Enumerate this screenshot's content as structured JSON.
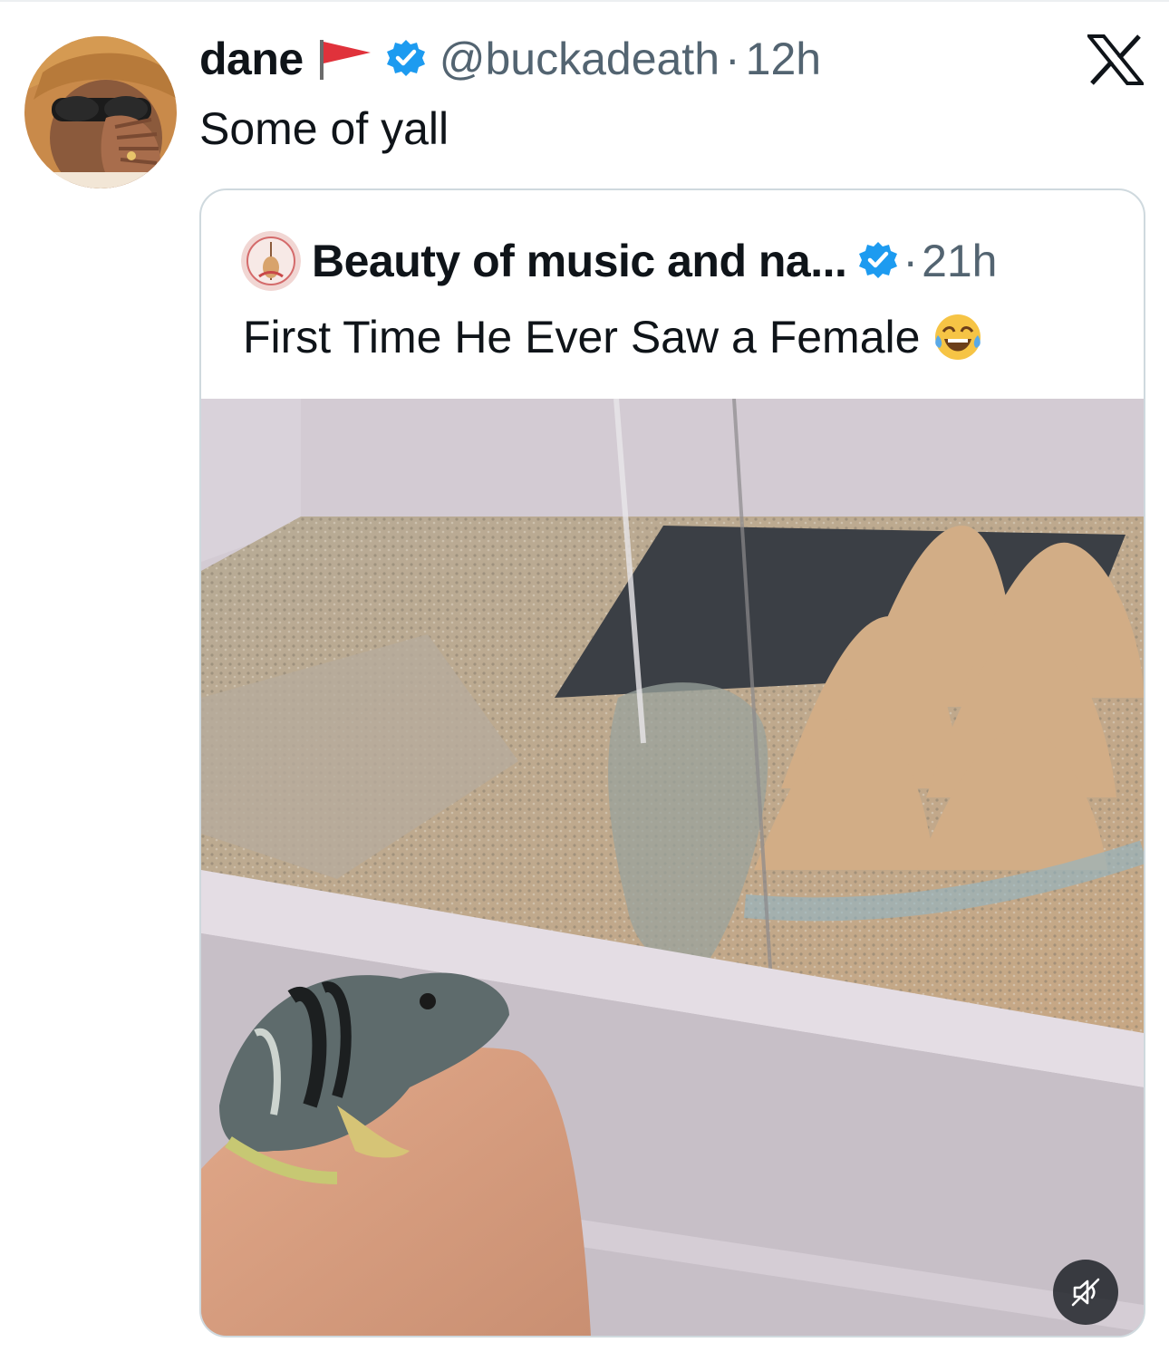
{
  "tweet": {
    "display_name": "dane",
    "handle": "@buckadeath",
    "separator": "·",
    "time": "12h",
    "text": "Some of yall",
    "flag_icon": "triangular-red-flag-icon",
    "verified_icon": "verified-badge-icon",
    "app_icon": "x-logo-icon"
  },
  "quoted_tweet": {
    "display_name": "Beauty of music and na...",
    "separator": "·",
    "time": "21h",
    "text": "First Time He Ever Saw a Female",
    "emoji_icon": "tears-of-joy-emoji-icon",
    "verified_icon": "verified-badge-icon",
    "media": {
      "type": "video",
      "mute_icon": "muted-speaker-icon",
      "muted": true
    }
  },
  "colors": {
    "text_primary": "#0f1419",
    "text_secondary": "#536471",
    "verified_blue": "#1d9bf0",
    "card_border": "#cfd9de"
  }
}
